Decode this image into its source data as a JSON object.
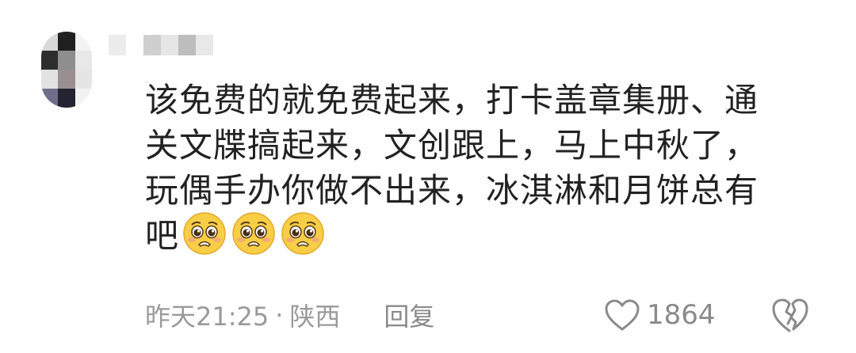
{
  "comment": {
    "lines": [
      "该免费的就免费起来，打卡盖章集册、通",
      "关文牒搞起来，文创跟上，马上中秋了，",
      "玩偶手办你做不出来，冰淇淋和月饼总有",
      "吧"
    ],
    "emoji": [
      "pleading-face-emoji",
      "pleading-face-emoji",
      "pleading-face-emoji"
    ]
  },
  "meta": {
    "time": "昨天21:25",
    "separator": "·",
    "location": "陕西",
    "reply_label": "回复"
  },
  "likes": {
    "count": "1864",
    "icon": "heart-outline-icon"
  },
  "dislike": {
    "icon": "broken-heart-icon"
  },
  "colors": {
    "text": "#222222",
    "meta": "#9a9a9a",
    "emoji_face": "#F7CE46"
  }
}
